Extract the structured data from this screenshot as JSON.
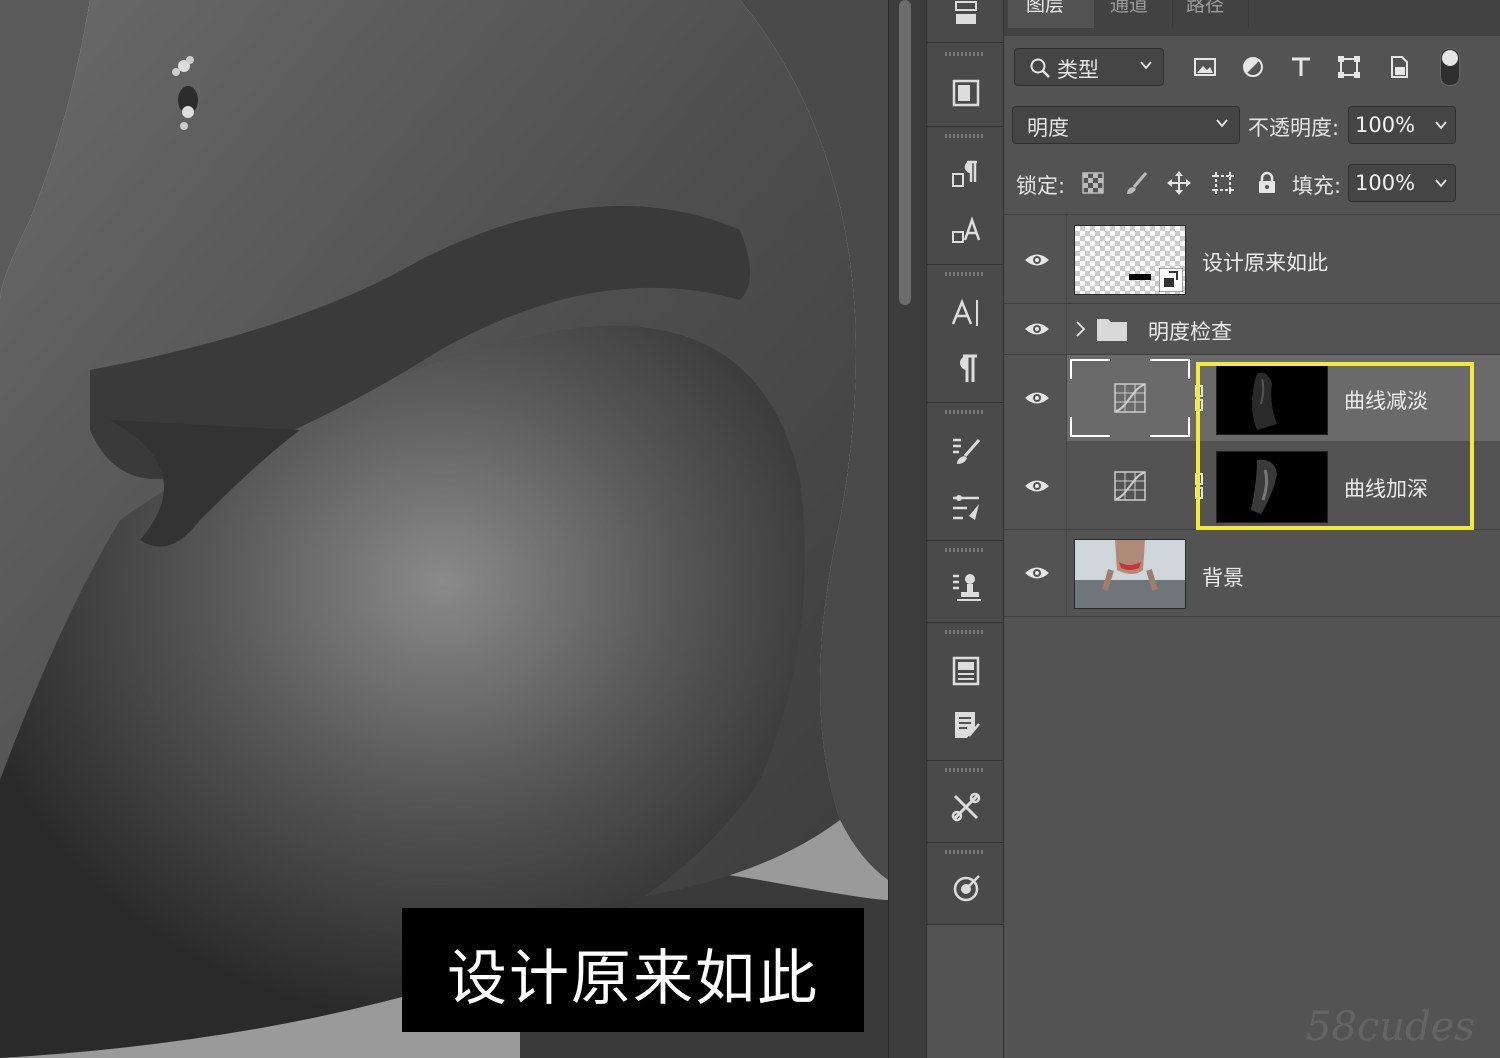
{
  "canvas": {
    "caption": "设计原来如此"
  },
  "panel": {
    "tabs": [
      "图层",
      "通道",
      "路径"
    ],
    "filter": {
      "label": "类型"
    },
    "blend_mode": "明度",
    "opacity": {
      "label": "不透明度:",
      "value": "100%"
    },
    "lock": {
      "label": "锁定:"
    },
    "fill": {
      "label": "填充:",
      "value": "100%"
    },
    "layers": [
      {
        "name": "设计原来如此",
        "kind": "smart-object",
        "visible": true
      },
      {
        "name": "明度检查",
        "kind": "group",
        "visible": true
      },
      {
        "name": "曲线减淡",
        "kind": "curves-adjustment",
        "visible": true,
        "selected": true
      },
      {
        "name": "曲线加深",
        "kind": "curves-adjustment",
        "visible": true
      },
      {
        "name": "背景",
        "kind": "image",
        "visible": true
      }
    ]
  },
  "toolstrip": {
    "icons": [
      "3d-layers-icon",
      "properties-icon",
      "paragraph-styles-icon",
      "character-styles-icon",
      "character-icon",
      "paragraph-icon",
      "brush-settings-icon",
      "brush-presets-icon",
      "clone-source-icon",
      "libraries-icon",
      "notes-icon",
      "tools-icon",
      "adjustments-target-icon"
    ]
  },
  "watermark": "58cudes",
  "colors": {
    "highlight": "#f2ea3c",
    "panel_bg": "#535353",
    "selected_row": "#6a6a6a"
  }
}
